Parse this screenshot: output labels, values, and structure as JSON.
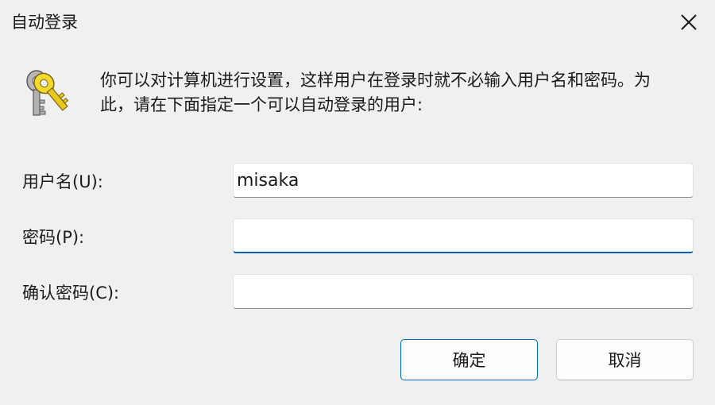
{
  "window": {
    "title": "自动登录"
  },
  "icons": {
    "close": "close-icon",
    "keys": "keys-icon"
  },
  "instructions": {
    "text": "你可以对计算机进行设置，这样用户在登录时就不必输入用户名和密码。为此，请在下面指定一个可以自动登录的用户:"
  },
  "fields": {
    "username": {
      "label": "用户名(U):",
      "value": "misaka"
    },
    "password": {
      "label": "密码(P):",
      "value": ""
    },
    "confirm_password": {
      "label": "确认密码(C):",
      "value": ""
    }
  },
  "buttons": {
    "ok": "确定",
    "cancel": "取消"
  },
  "colors": {
    "accent": "#005fb8",
    "background": "#f0f0f0",
    "primary_border": "#0067c0"
  }
}
